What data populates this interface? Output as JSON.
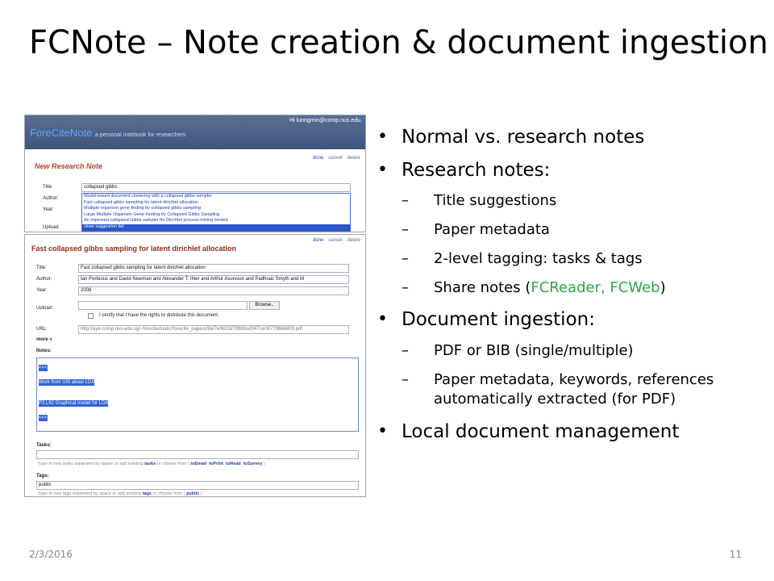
{
  "slide": {
    "title": "FCNote – Note creation & document ingestion",
    "date": "2/3/2016",
    "page_number": "11"
  },
  "bullets": [
    {
      "text": "Normal vs. research notes"
    },
    {
      "text": "Research notes:"
    },
    {
      "text": "Title suggestions"
    },
    {
      "text": "Paper metadata"
    },
    {
      "text": "2-level tagging: tasks & tags"
    },
    {
      "pre": "Share notes (",
      "highlight": "FCReader, FCWeb",
      "post": ")",
      "highlight_color": "#2ea84a"
    },
    {
      "text": "Document ingestion:"
    },
    {
      "text": "PDF or BIB (single/multiple)"
    },
    {
      "text": "Paper metadata, keywords, references"
    },
    {
      "text": "automatically extracted (for PDF)"
    },
    {
      "text": "Local document management"
    }
  ],
  "screenshot_top": {
    "user_greeting": "Hi luongmin@comp.nus.edu.",
    "app_name": "ForeCiteNote",
    "tagline": "a personal notebook for researchers",
    "links": {
      "done": "done",
      "cancel": "cancel",
      "delete": "delete"
    },
    "page_title": "New Research Note",
    "labels": {
      "title": "Title:",
      "author": "Author:",
      "year": "Year:",
      "upload": "Upload:"
    },
    "title_value": "collapsed gibbs",
    "suggestions": [
      "Model-based document clustering with a collapsed gibbs sampler",
      "Fast collapsed gibbs sampling for latent dirichlet allocation",
      "Multiple organism gene finding by collapsed gibbs sampling",
      "Large Multiple Organism Gene Finding by Collapsed Gibbs Sampling",
      "An improved collapsed Gibbs sampler for Dirichlet process mixing models",
      "close suggestion list"
    ]
  },
  "screenshot_bottom": {
    "doc_title": "Fast collapsed gibbs sampling for latent dirichlet allocation",
    "links": {
      "done": "done",
      "cancel": "cancel",
      "delete": "delete"
    },
    "labels": {
      "title": "Title:",
      "author": "Author:",
      "year": "Year:",
      "upload": "Upload:",
      "url": "URL:",
      "more": "more »",
      "notes": "Notes:",
      "tasks": "Tasks:",
      "tags": "Tags:"
    },
    "title_value": "Fast collapsed gibbs sampling for latent dirichlet allocation",
    "author_value": "Ian Porteous and David Newman and Alexander T. Ihler and Arthur Asuncion and Padhraic Smyth and M",
    "year_value": "2008",
    "browse_label": "Browse..",
    "certify_text": "I certify that I have the rights to distribute this document",
    "url_value": "http://aye.comp.nus.edu.sg/~forecite/static/forecite_papers/9e/7e/6f/2d/78fb9ce5f47ce06779666803.pdf",
    "notes_lines": [
      "<<<",
      "Work from USI about LDA",
      "",
      "P2,L62 Graphical model for LDA",
      "<<<"
    ],
    "tasks_hint": {
      "pre": "Type in new tasks separated by space or add existing",
      "tasks": "tasks",
      "or": "or choose from (",
      "items": [
        "toEmail",
        "toPrint",
        "toRead",
        "toSurvey"
      ],
      "post": ")"
    },
    "tags_value": "public",
    "tags_hint": {
      "pre": "Type in new tags separated by space or add existing",
      "tags": "tags",
      "or": "or choose from (",
      "items": [
        "public"
      ],
      "post": ")"
    }
  }
}
